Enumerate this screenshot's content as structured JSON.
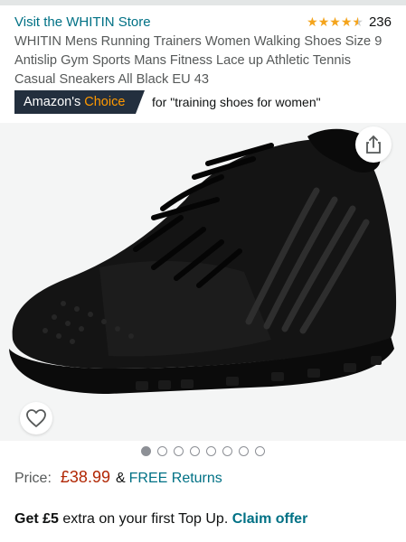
{
  "store": {
    "link_text": "Visit the WHITIN Store"
  },
  "rating": {
    "stars": 4.5,
    "count": "236",
    "color": "#f4a41c"
  },
  "product": {
    "title": "WHITIN Mens Running Trainers Women Walking Shoes Size 9 Antislip Gym Sports Mans Fitness Lace up Athletic Tennis Casual Sneakers All Black EU 43"
  },
  "badge": {
    "prefix": "Amazon's",
    "accent": "Choice",
    "query": "for \"training shoes for women\""
  },
  "gallery": {
    "image_count": 8,
    "active_index": 0,
    "share_icon": "share-icon",
    "wishlist_icon": "heart-icon"
  },
  "price": {
    "label": "Price:",
    "value": "£38.99",
    "amp": "&",
    "returns": "FREE Returns"
  },
  "offer": {
    "strong": "Get £5",
    "text": " extra on your first Top Up. ",
    "link": "Claim offer"
  },
  "colors": {
    "link": "#007185",
    "price": "#b12704",
    "badge_bg": "#232f3e",
    "badge_accent": "#ff9900"
  }
}
